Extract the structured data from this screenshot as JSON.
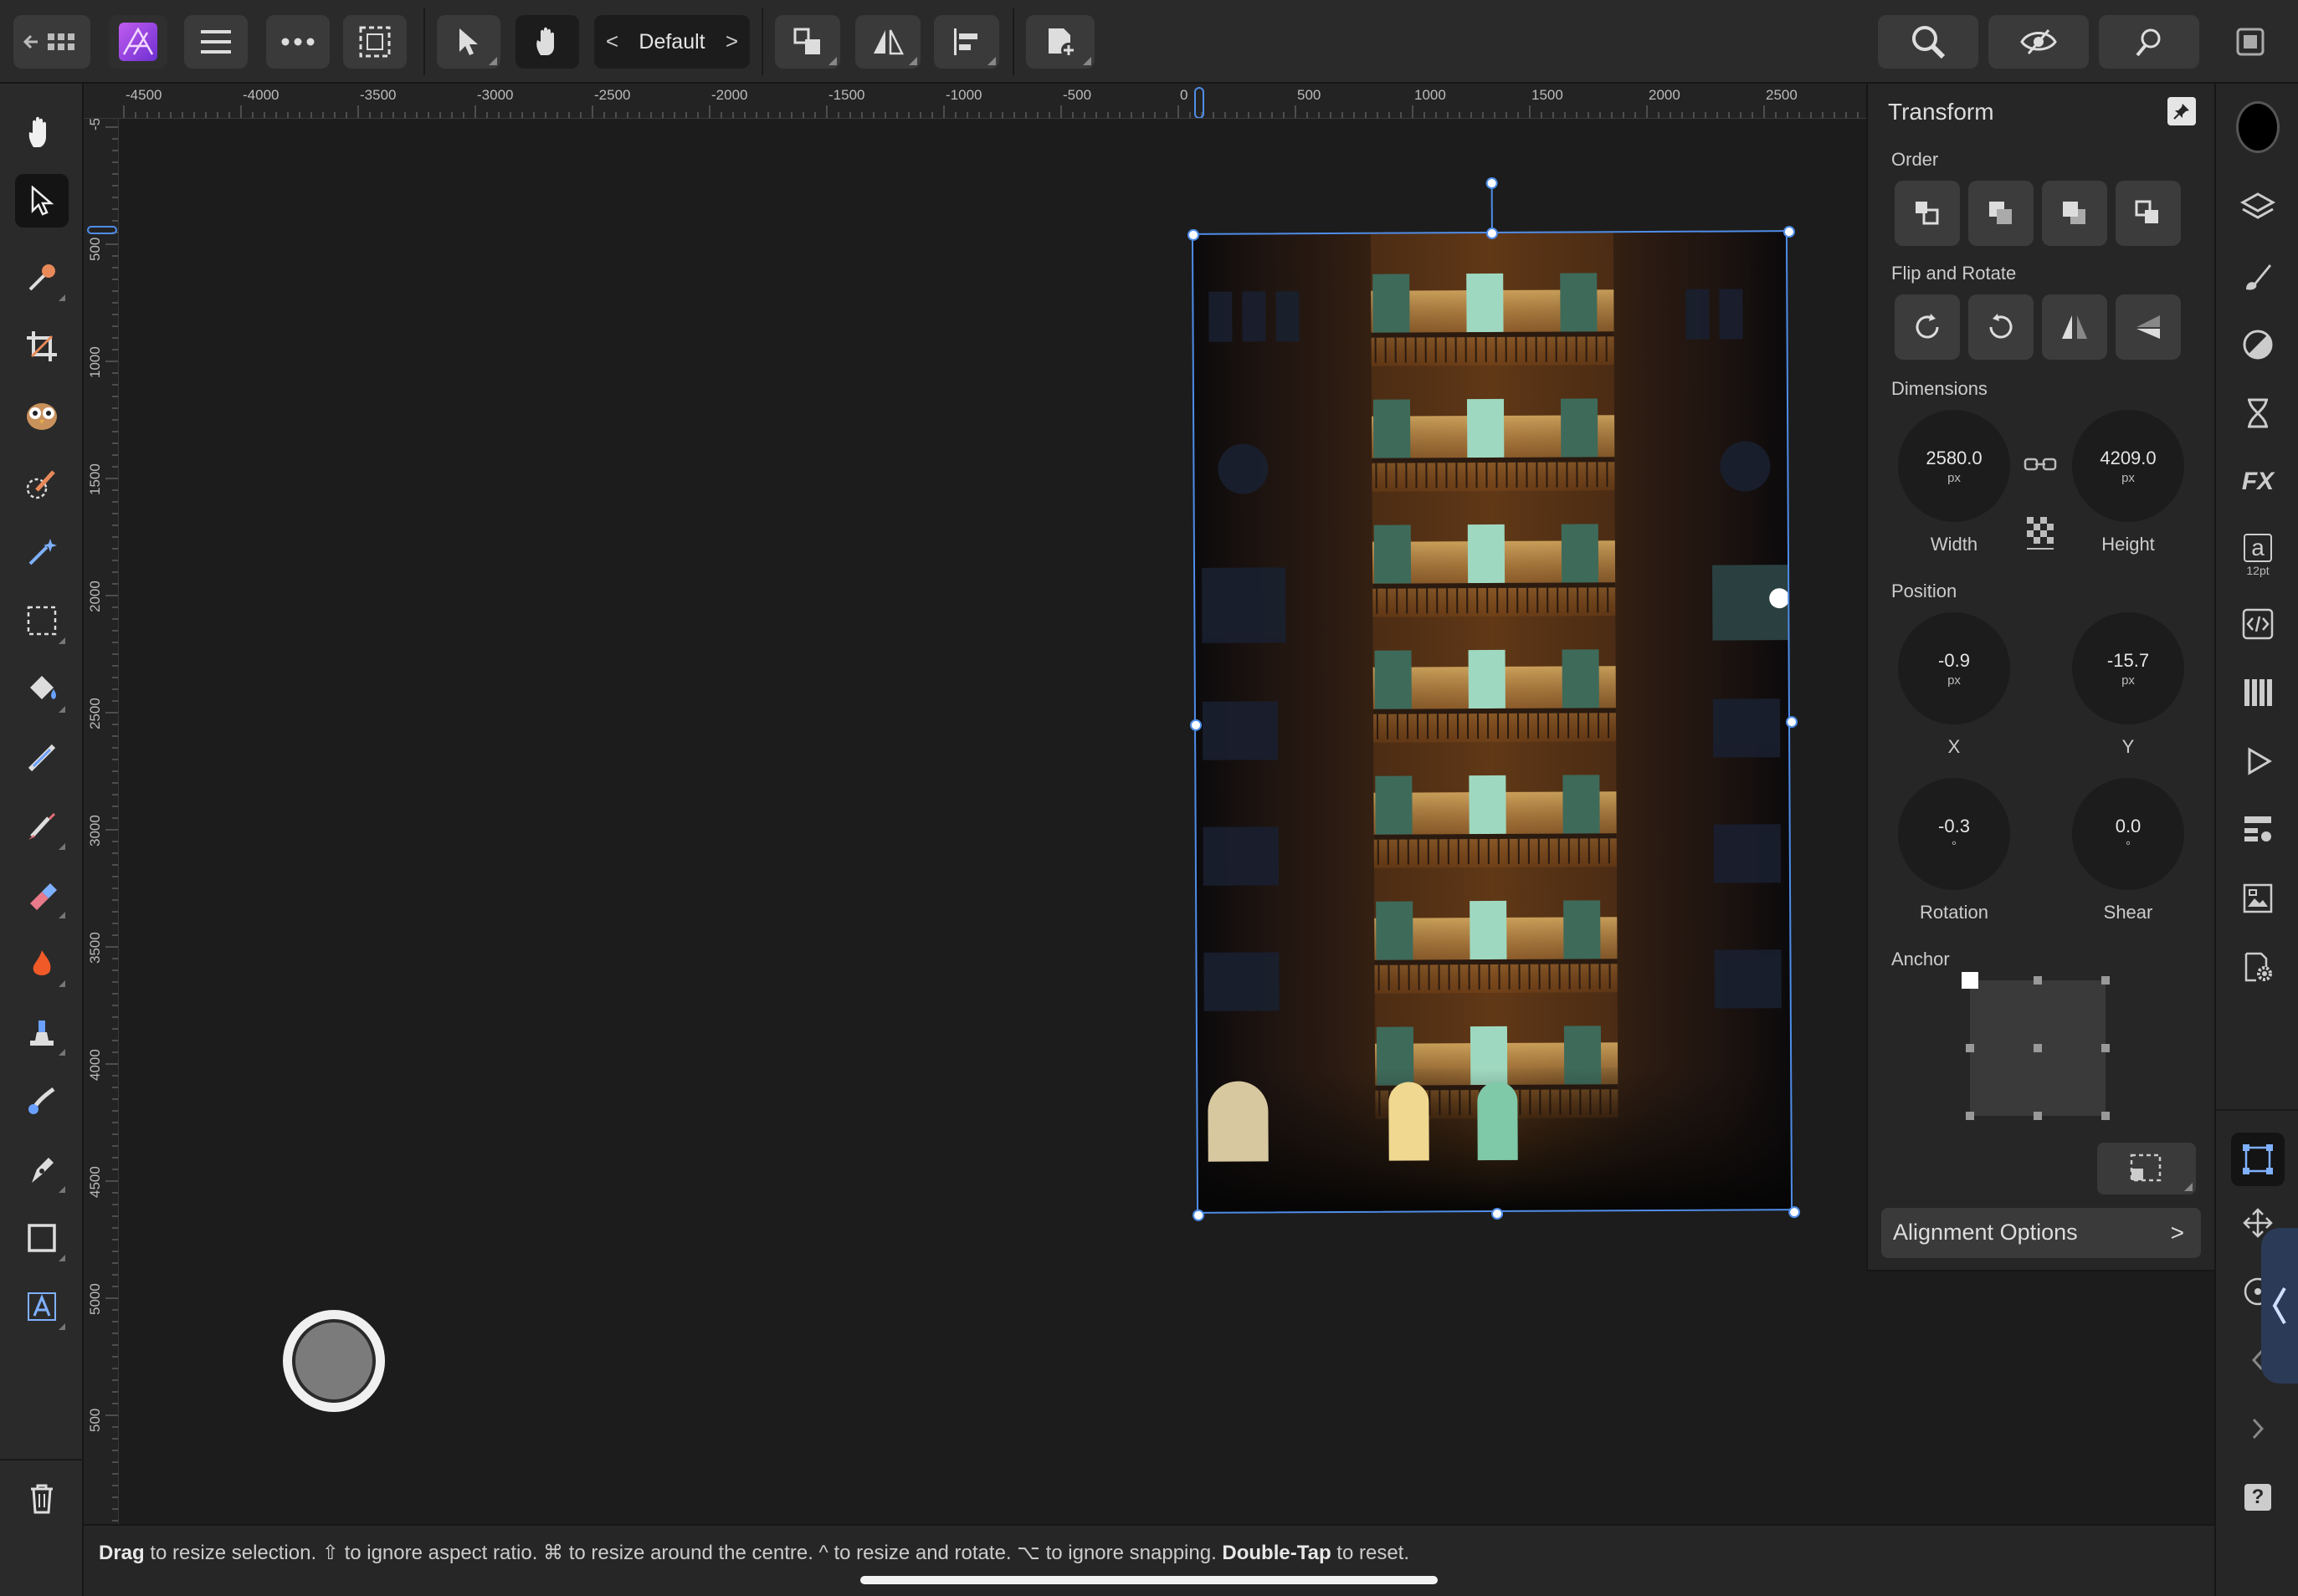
{
  "toolbar": {
    "persona": "Default",
    "prev_glyph": "<",
    "next_glyph": ">"
  },
  "rulers": {
    "unit": "px",
    "top_labels": [
      "-4500",
      "-4000",
      "-3500",
      "-3000",
      "-2500",
      "-2000",
      "-1500",
      "-1000",
      "-500",
      "0",
      "500",
      "1000",
      "1500",
      "2000",
      "2500"
    ],
    "left_labels": [
      "-5",
      "500",
      "1000",
      "1500",
      "2000",
      "2500",
      "3000",
      "3500",
      "4000",
      "4500",
      "5000",
      "500"
    ]
  },
  "transform": {
    "title": "Transform",
    "order_label": "Order",
    "flip_rotate_label": "Flip and Rotate",
    "dimensions_label": "Dimensions",
    "width": {
      "value": "2580.0",
      "unit": "px",
      "label": "Width"
    },
    "height": {
      "value": "4209.0",
      "unit": "px",
      "label": "Height"
    },
    "position_label": "Position",
    "x": {
      "value": "-0.9",
      "unit": "px",
      "label": "X"
    },
    "y": {
      "value": "-15.7",
      "unit": "px",
      "label": "Y"
    },
    "rotation": {
      "value": "-0.3",
      "unit": "°",
      "label": "Rotation"
    },
    "shear": {
      "value": "0.0",
      "unit": "°",
      "label": "Shear"
    },
    "anchor_label": "Anchor",
    "alignment_options": "Alignment Options",
    "alignment_chevron": ">"
  },
  "studio": {
    "character_size": "12pt",
    "character_glyph": "a",
    "help_glyph": "?"
  },
  "status": {
    "part1_bold": "Drag",
    "part1": " to resize selection. ⇧ to ignore aspect ratio. ⌘ to resize around the centre. ^ to resize and rotate. ⌥ to ignore snapping. ",
    "part2_bold": "Double-Tap",
    "part2": " to reset."
  },
  "colors": {
    "accent": "#4f8de8",
    "app_logo": "#a347e6",
    "panel_bg": "#262626",
    "canvas_bg": "#1c1c1c"
  }
}
